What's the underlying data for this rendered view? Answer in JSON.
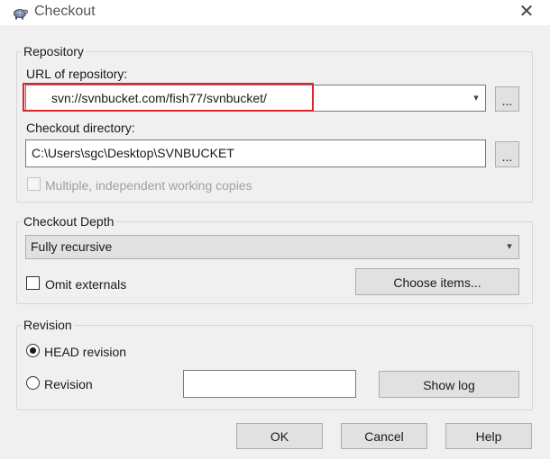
{
  "window": {
    "title": "Checkout",
    "close_glyph": "✕"
  },
  "repository": {
    "group_label": "Repository",
    "url_label": "URL of repository:",
    "url_value": "svn://svnbucket.com/fish77/svnbucket/",
    "browse_label": "...",
    "dir_label": "Checkout directory:",
    "dir_value": "C:\\Users\\sgc\\Desktop\\SVNBUCKET",
    "multiple_label": "Multiple, independent working copies",
    "highlight_color": "#e0242c"
  },
  "depth": {
    "group_label": "Checkout Depth",
    "selected": "Fully recursive",
    "omit_label": "Omit externals",
    "choose_label": "Choose items..."
  },
  "revision": {
    "group_label": "Revision",
    "head_label": "HEAD revision",
    "rev_label": "Revision",
    "rev_value": "",
    "showlog_label": "Show log"
  },
  "buttons": {
    "ok": "OK",
    "cancel": "Cancel",
    "help": "Help"
  }
}
